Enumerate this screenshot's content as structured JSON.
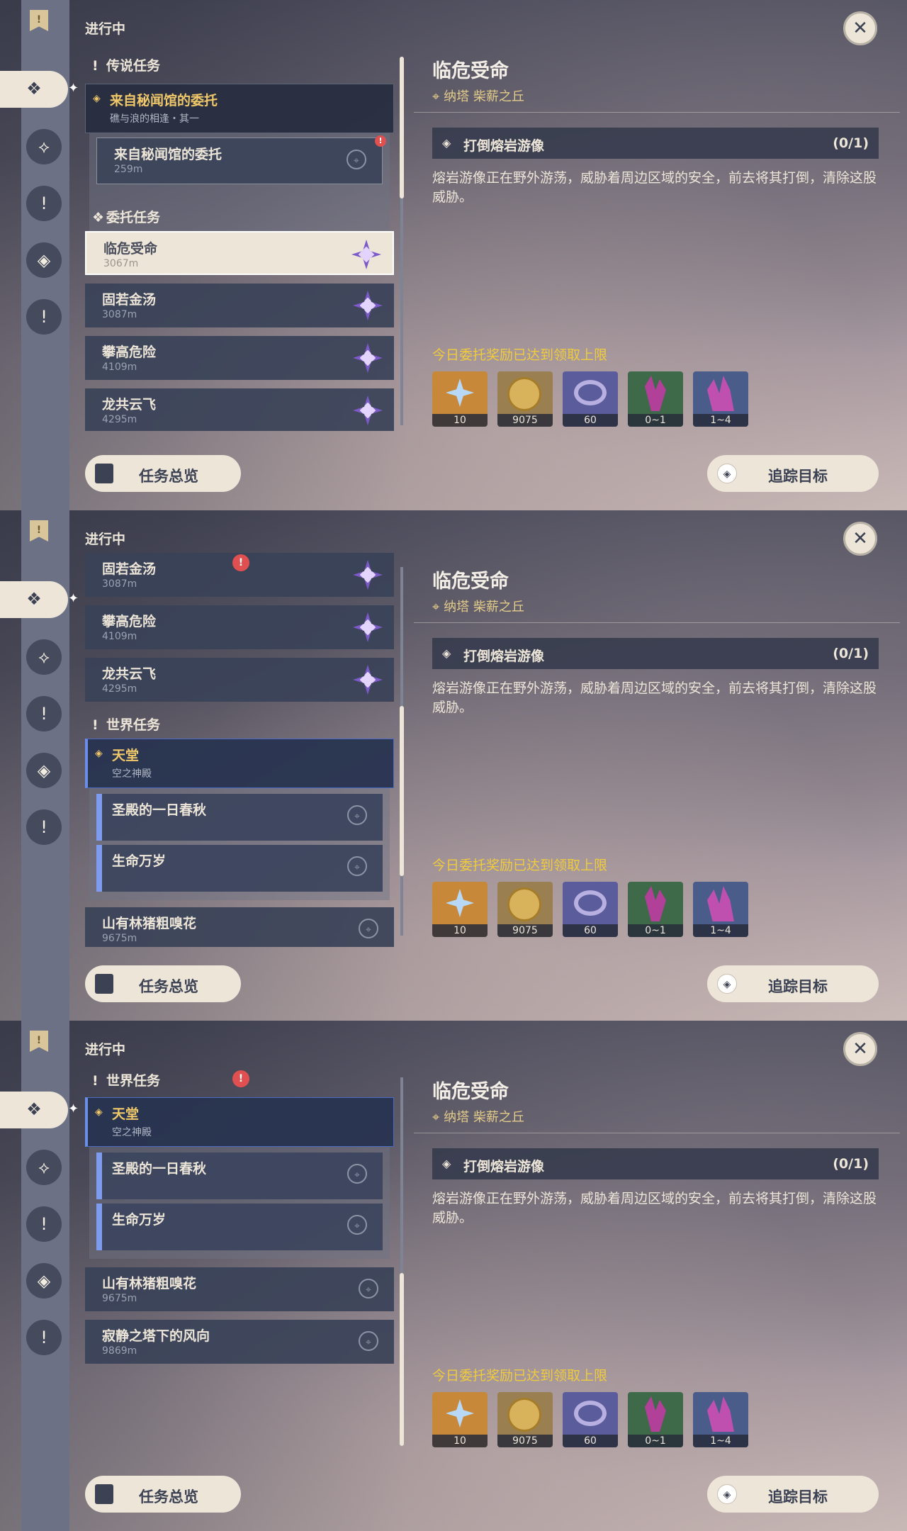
{
  "status": "进行中",
  "categories": {
    "legend": "传说任务",
    "commission": "委托任务",
    "world": "世界任务"
  },
  "quests": {
    "legend_main": {
      "title": "来自秘闻馆的委托",
      "sub": "礁与浪的相逢・其一"
    },
    "legend_step": {
      "title": "来自秘闻馆的委托",
      "dist": "259m"
    },
    "c1": {
      "title": "临危受命",
      "dist": "3067m"
    },
    "c2": {
      "title": "固若金汤",
      "dist": "3087m"
    },
    "c3": {
      "title": "攀高危险",
      "dist": "4109m"
    },
    "c4": {
      "title": "龙共云飞",
      "dist": "4295m"
    },
    "world_main": {
      "title": "天堂",
      "sub": "空之神殿"
    },
    "w_step1": {
      "title": "圣殿的一日春秋"
    },
    "w_step2": {
      "title": "生命万岁"
    },
    "w2": {
      "title": "山有林猪粗嗅花",
      "dist": "9675m"
    },
    "w3": {
      "title": "寂静之塔下的风向",
      "dist": "9869m"
    }
  },
  "alert_mark": "!",
  "detail": {
    "title": "临危受命",
    "region": "纳塔",
    "area": "柴薪之丘",
    "objective": "打倒熔岩游像",
    "progress": "(0/1)",
    "description": "熔岩游像正在野外游荡，威胁着周边区域的安全，前去将其打倒，清除这股威胁。",
    "reward_limit": "今日委托奖励已达到领取上限",
    "rewards": [
      {
        "icon": "primogem-icon",
        "count": "10"
      },
      {
        "icon": "mora-icon",
        "count": "9075"
      },
      {
        "icon": "companionship-exp-icon",
        "count": "60"
      },
      {
        "icon": "crystal-chunk-icon",
        "count": "0~1"
      },
      {
        "icon": "crystal-cluster-icon",
        "count": "1~4"
      }
    ]
  },
  "buttons": {
    "overview": "任务总览",
    "track": "追踪目标"
  },
  "icons": {
    "close": "✕",
    "bookmark": "!",
    "commission": "❖",
    "legend": "⟡",
    "world": "!",
    "event": "◈",
    "pin": "⌖",
    "diamond": "◈"
  },
  "colors": {
    "accent_gold": "#f0c86a",
    "limit_yellow": "#f0cc3c",
    "alert_red": "#e05050",
    "world_blue": "#6b8ee8",
    "commission_purple": "#7c5ac8"
  }
}
